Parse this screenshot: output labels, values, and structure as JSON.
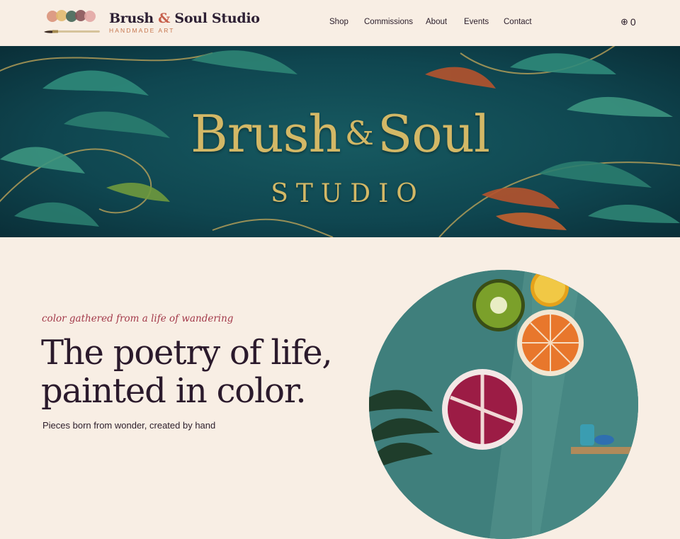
{
  "brand": {
    "name_part1": "Brush ",
    "ampersand": "&",
    "name_part2": " Soul Studio",
    "tagline": "HANDMADE ART"
  },
  "nav": {
    "items": [
      {
        "label": "Shop"
      },
      {
        "label": "Commissions"
      },
      {
        "label": "About"
      },
      {
        "label": "Events"
      },
      {
        "label": "Contact"
      }
    ]
  },
  "cart": {
    "icon": "cart-icon",
    "count": "0"
  },
  "banner": {
    "title_word1": "Brush",
    "ampersand": "&",
    "title_word2": "Soul",
    "subtitle": "STUDIO",
    "colors": {
      "gold": "#d3b866",
      "teal": "#10434e"
    }
  },
  "intro": {
    "tagline": "color gathered from a life of wandering",
    "headline": "The poetry of life, painted in color.",
    "body": "Pieces born from wonder, created by hand"
  },
  "colors": {
    "background": "#f8eee4",
    "accent": "#a3394a",
    "text": "#2b1a2c"
  }
}
